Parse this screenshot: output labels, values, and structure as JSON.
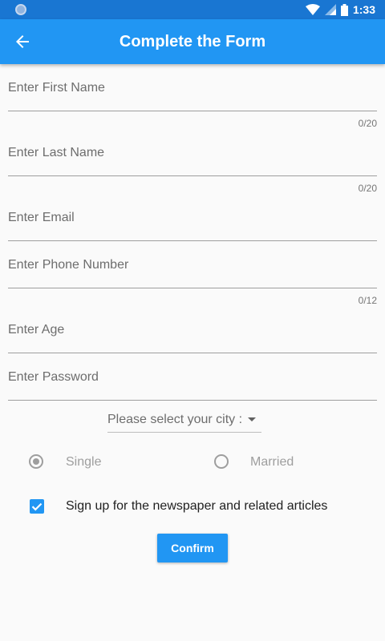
{
  "status_bar": {
    "time": "1:33",
    "icons": [
      "notification-dot-icon",
      "wifi-icon",
      "signal-icon",
      "battery-icon"
    ]
  },
  "app_bar": {
    "title": "Complete the Form",
    "back_icon": "arrow-back-icon",
    "color": "#2196f3",
    "status_color": "#1976d2"
  },
  "form": {
    "first_name": {
      "label": "Enter First Name",
      "value": "",
      "counter": "0/20"
    },
    "last_name": {
      "label": "Enter Last Name",
      "value": "",
      "counter": "0/20"
    },
    "email": {
      "label": "Enter Email",
      "value": ""
    },
    "phone": {
      "label": "Enter Phone Number",
      "value": "",
      "counter": "0/12"
    },
    "age": {
      "label": "Enter Age",
      "value": ""
    },
    "password": {
      "label": "Enter Password",
      "value": ""
    },
    "city_dropdown": {
      "placeholder": "Please select your city :",
      "selected": ""
    },
    "marital_status": {
      "options": [
        {
          "label": "Single",
          "selected": true
        },
        {
          "label": "Married",
          "selected": false
        }
      ]
    },
    "newsletter": {
      "label": "Sign up for the newspaper and related articles",
      "checked": true
    },
    "confirm_label": "Confirm"
  }
}
